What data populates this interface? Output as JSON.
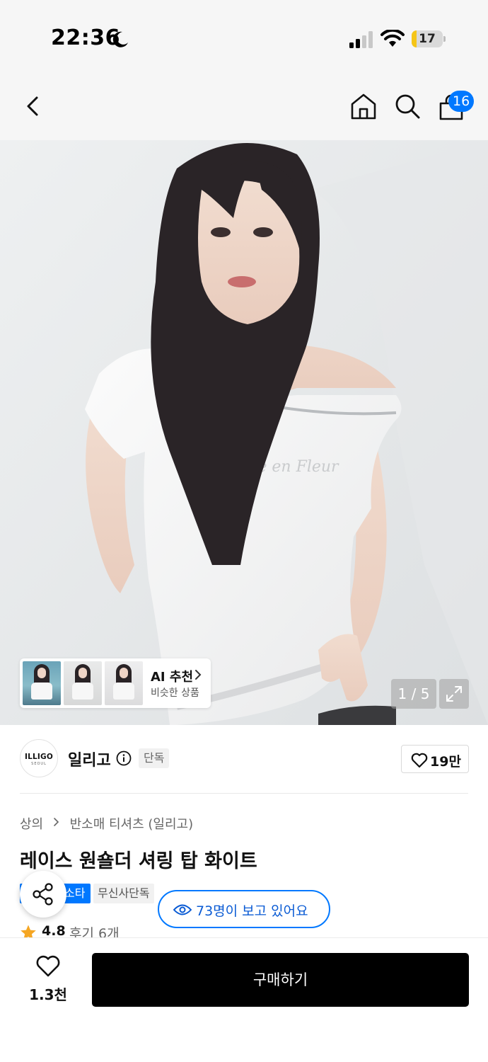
{
  "status_bar": {
    "time": "22:36",
    "battery_level": "17",
    "battery_fraction": 0.17,
    "battery_color": "#f5c518",
    "icons": [
      "moon-icon",
      "cellular-signal-icon",
      "wifi-icon",
      "battery-icon"
    ]
  },
  "nav": {
    "icons": [
      "back-icon",
      "home-icon",
      "search-icon",
      "shopping-bag-icon"
    ],
    "cart_count": "16",
    "badge_color": "#0078ff"
  },
  "hero": {
    "page_counter": "1 / 5",
    "current_page": 1,
    "total_pages": 5,
    "ai_recommend": {
      "title": "AI 추천",
      "subtitle": "비슷한 상품"
    }
  },
  "brand": {
    "logo_text": "ILLIGO",
    "logo_subtext": "SEOUL",
    "name": "일리고",
    "exclusive_tag": "단독",
    "like_count": "19만"
  },
  "product": {
    "breadcrumb": [
      "상의",
      "반소매 티셔츠 (일리고)"
    ],
    "title": "레이스 원숄더 셔링 탑 화이트",
    "tags": [
      "소타",
      "무신사단독"
    ],
    "viewers": "73명이 보고 있어요",
    "rating": "4.8",
    "reviews": "후기 6개"
  },
  "bottom_bar": {
    "wish_count": "1.3천",
    "buy_label": "구매하기"
  },
  "colors": {
    "accent": "#0078ff",
    "buy_button": "#000000",
    "star": "#f5a623"
  }
}
